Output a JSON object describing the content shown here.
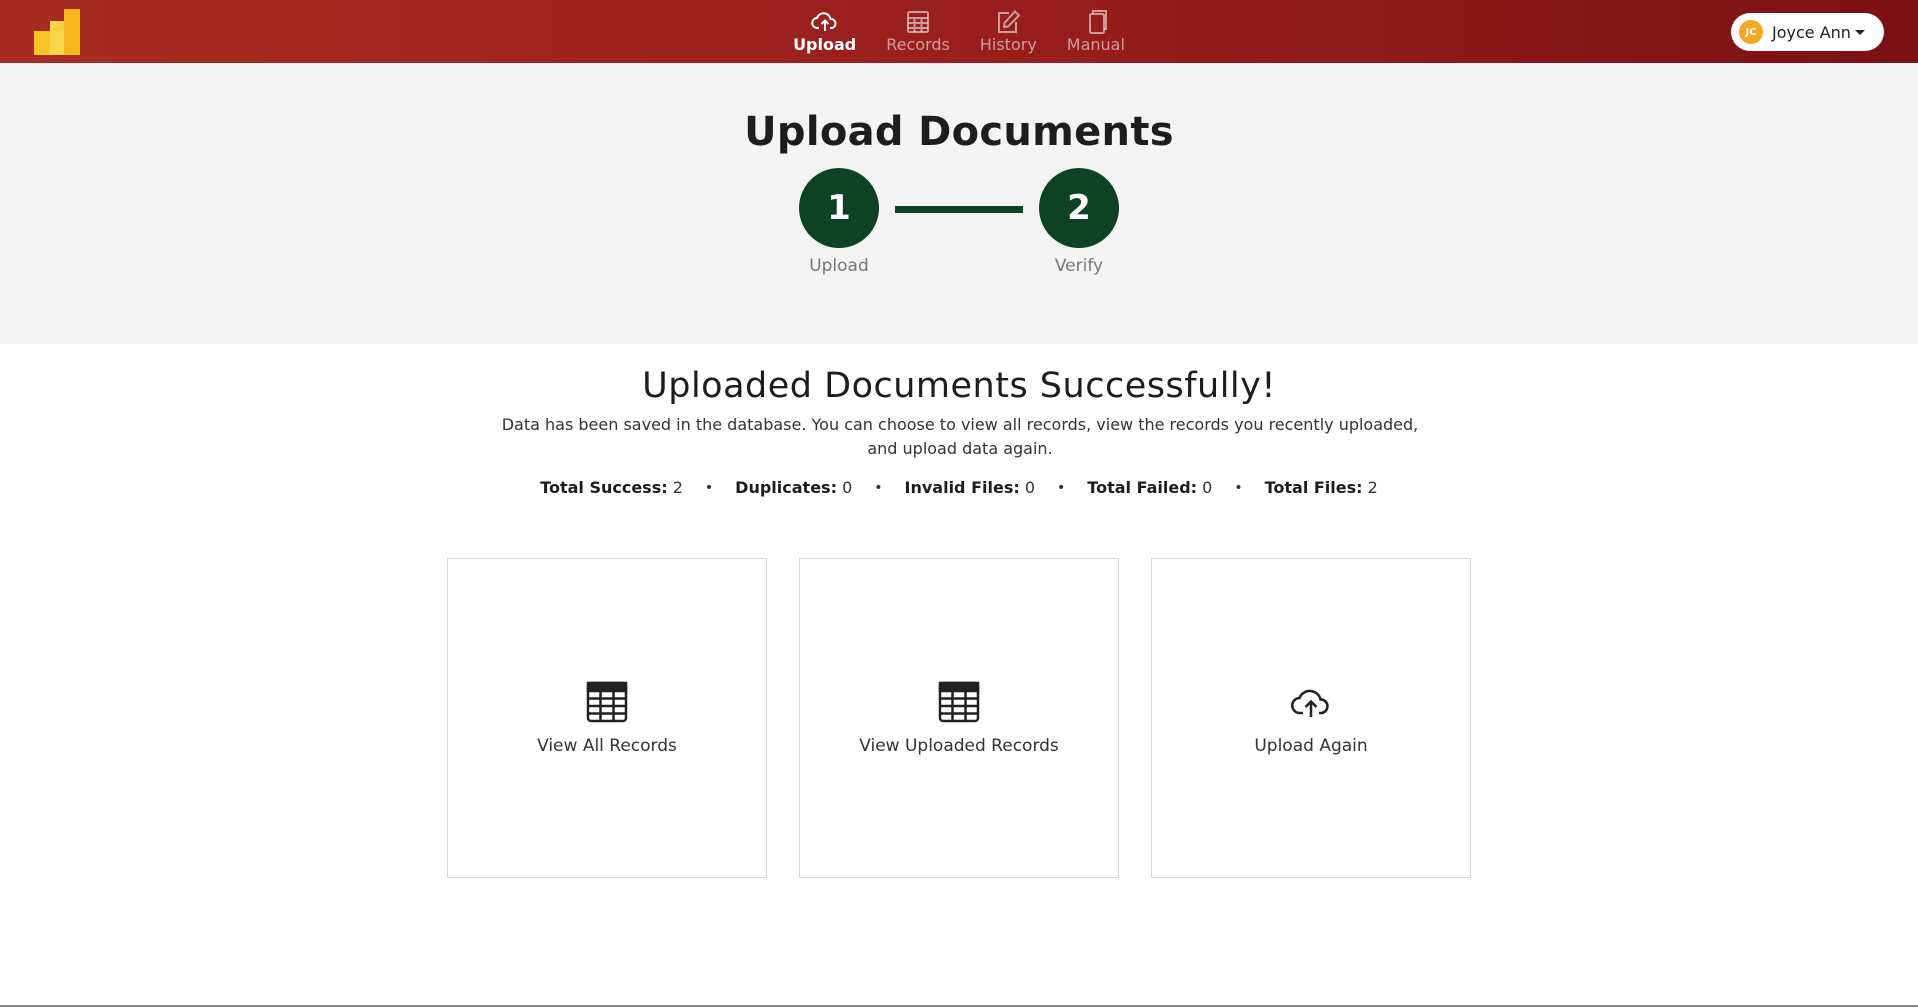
{
  "navbar": {
    "items": [
      {
        "label": "Upload",
        "icon": "cloud-upload-icon",
        "active": true
      },
      {
        "label": "Records",
        "icon": "table-icon",
        "active": false
      },
      {
        "label": "History",
        "icon": "edit-icon",
        "active": false
      },
      {
        "label": "Manual",
        "icon": "copy-icon",
        "active": false
      }
    ],
    "user": {
      "initials": "JC",
      "name": "Joyce Ann"
    }
  },
  "header": {
    "title": "Upload Documents",
    "steps": [
      {
        "number": "1",
        "label": "Upload"
      },
      {
        "number": "2",
        "label": "Verify"
      }
    ]
  },
  "result": {
    "title": "Uploaded Documents Successfully!",
    "description": "Data has been saved in the database. You can choose to view all records, view the records you recently uploaded, and upload data again.",
    "stats": [
      {
        "label": "Total Success:",
        "value": "2"
      },
      {
        "label": "Duplicates:",
        "value": "0"
      },
      {
        "label": "Invalid Files:",
        "value": "0"
      },
      {
        "label": "Total Failed:",
        "value": "0"
      },
      {
        "label": "Total Files:",
        "value": "2"
      }
    ]
  },
  "cards": [
    {
      "label": "View All Records",
      "icon": "table-icon"
    },
    {
      "label": "View Uploaded Records",
      "icon": "table-icon"
    },
    {
      "label": "Upload Again",
      "icon": "cloud-upload-icon"
    }
  ],
  "colors": {
    "navbar_start": "#a82c22",
    "navbar_end": "#7c1014",
    "step_green": "#0d4323",
    "avatar": "#f5a623",
    "logo_yellow": "#f7c325"
  }
}
